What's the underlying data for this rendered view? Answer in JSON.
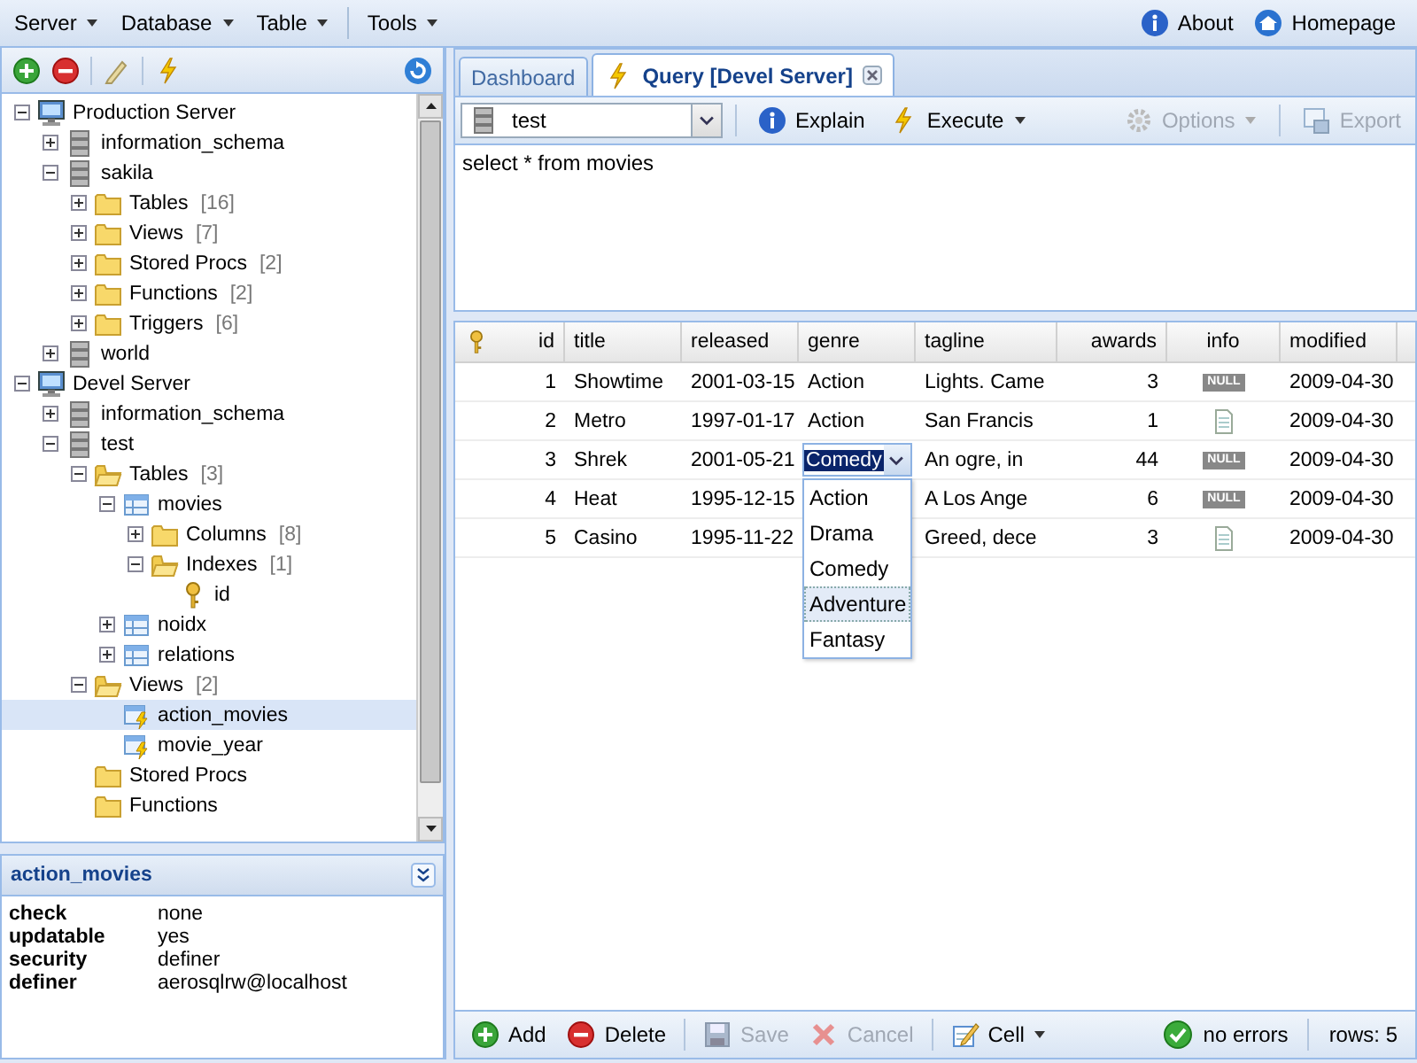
{
  "menu": {
    "groups": [
      [
        {
          "label": "Server"
        },
        {
          "label": "Database"
        },
        {
          "label": "Table"
        }
      ],
      [
        {
          "label": "Tools"
        }
      ]
    ],
    "links": [
      {
        "label": "About",
        "kind": "info"
      },
      {
        "label": "Homepage",
        "kind": "home"
      }
    ]
  },
  "tree": [
    {
      "label": "Production Server",
      "kind": "server",
      "expanded": true,
      "selected": false,
      "children": [
        {
          "label": "information_schema",
          "kind": "database",
          "expanded": false,
          "selected": false
        },
        {
          "label": "sakila",
          "kind": "database",
          "expanded": true,
          "selected": false,
          "children": [
            {
              "label": "Tables",
              "count": "[16]",
              "kind": "folder",
              "expanded": false,
              "selected": false
            },
            {
              "label": "Views",
              "count": "[7]",
              "kind": "folder",
              "expanded": false,
              "selected": false
            },
            {
              "label": "Stored Procs",
              "count": "[2]",
              "kind": "folder",
              "expanded": false,
              "selected": false
            },
            {
              "label": "Functions",
              "count": "[2]",
              "kind": "folder",
              "expanded": false,
              "selected": false
            },
            {
              "label": "Triggers",
              "count": "[6]",
              "kind": "folder",
              "expanded": false,
              "selected": false
            }
          ]
        },
        {
          "label": "world",
          "kind": "database",
          "expanded": false,
          "selected": false
        }
      ]
    },
    {
      "label": "Devel Server",
      "kind": "server",
      "expanded": true,
      "selected": false,
      "children": [
        {
          "label": "information_schema",
          "kind": "database",
          "expanded": false,
          "selected": false
        },
        {
          "label": "test",
          "kind": "database",
          "expanded": true,
          "selected": false,
          "children": [
            {
              "label": "Tables",
              "count": "[3]",
              "kind": "folder",
              "expanded": true,
              "selected": false,
              "children": [
                {
                  "label": "movies",
                  "kind": "table",
                  "expanded": true,
                  "selected": false,
                  "children": [
                    {
                      "label": "Columns",
                      "count": "[8]",
                      "kind": "folder",
                      "expanded": false,
                      "selected": false
                    },
                    {
                      "label": "Indexes",
                      "count": "[1]",
                      "kind": "folder",
                      "expanded": true,
                      "selected": false,
                      "children": [
                        {
                          "label": "id",
                          "kind": "key",
                          "selected": false
                        }
                      ]
                    }
                  ]
                },
                {
                  "label": "noidx",
                  "kind": "table",
                  "expanded": false,
                  "selected": false
                },
                {
                  "label": "relations",
                  "kind": "table",
                  "expanded": false,
                  "selected": false
                }
              ]
            },
            {
              "label": "Views",
              "count": "[2]",
              "kind": "folder",
              "expanded": true,
              "selected": false,
              "children": [
                {
                  "label": "action_movies",
                  "kind": "view",
                  "selected": true
                },
                {
                  "label": "movie_year",
                  "kind": "view",
                  "selected": false
                }
              ]
            },
            {
              "label": "Stored Procs",
              "kind": "folder",
              "selected": false
            },
            {
              "label": "Functions",
              "kind": "folder",
              "selected": false
            }
          ]
        }
      ]
    }
  ],
  "details": {
    "title": "action_movies",
    "properties": [
      {
        "name": "check",
        "value": "none"
      },
      {
        "name": "updatable",
        "value": "yes"
      },
      {
        "name": "security",
        "value": "definer"
      },
      {
        "name": "definer",
        "value": "aerosqlrw@localhost"
      }
    ]
  },
  "tabs": [
    {
      "label": "Dashboard",
      "kind": "plain",
      "selected": false,
      "closable": false
    },
    {
      "label": "Query [Devel Server]",
      "kind": "query",
      "selected": true,
      "closable": true
    }
  ],
  "query": {
    "database": "test",
    "sql": "select * from movies",
    "actions": [
      {
        "label": "Explain",
        "kind": "info",
        "disabled": false,
        "menu": false
      },
      {
        "label": "Execute",
        "kind": "execute",
        "disabled": false,
        "menu": true
      }
    ],
    "right_groups": [
      [
        {
          "label": "Options",
          "kind": "options",
          "disabled": true,
          "menu": true
        }
      ],
      [
        {
          "label": "Export",
          "kind": "export",
          "disabled": true,
          "menu": false
        }
      ]
    ]
  },
  "grid": {
    "columns": [
      {
        "label": "id",
        "kind": "number",
        "key": true
      },
      {
        "label": "title",
        "kind": "text"
      },
      {
        "label": "released",
        "kind": "text"
      },
      {
        "label": "genre",
        "kind": "text"
      },
      {
        "label": "tagline",
        "kind": "wide"
      },
      {
        "label": "awards",
        "kind": "number"
      },
      {
        "label": "info",
        "kind": "icon"
      },
      {
        "label": "modified",
        "kind": "text"
      }
    ],
    "rows": [
      {
        "cells": [
          "1",
          "Showtime",
          "2001-03-15",
          "Action",
          "Lights. Came",
          "3",
          {
            "kind": "null",
            "label": "NULL"
          },
          "2009-04-30"
        ]
      },
      {
        "cells": [
          "2",
          "Metro",
          "1997-01-17",
          "Action",
          "San Francis",
          "1",
          {
            "kind": "document"
          },
          "2009-04-30"
        ]
      },
      {
        "cells": [
          "3",
          "Shrek",
          "2001-05-21",
          {
            "kind": "editor",
            "value": "Comedy",
            "expanded": true,
            "options": [
              {
                "label": "Action",
                "highlighted": false
              },
              {
                "label": "Drama",
                "highlighted": false
              },
              {
                "label": "Comedy",
                "highlighted": false
              },
              {
                "label": "Adventure",
                "highlighted": true
              },
              {
                "label": "Fantasy",
                "highlighted": false
              }
            ]
          },
          "An ogre, in",
          "44",
          {
            "kind": "null",
            "label": "NULL"
          },
          "2009-04-30"
        ]
      },
      {
        "cells": [
          "4",
          "Heat",
          "1995-12-15",
          null,
          "A Los Ange",
          "6",
          {
            "kind": "null",
            "label": "NULL"
          },
          "2009-04-30"
        ]
      },
      {
        "cells": [
          "5",
          "Casino",
          "1995-11-22",
          null,
          "Greed, dece",
          "3",
          {
            "kind": "document"
          },
          "2009-04-30"
        ]
      }
    ]
  },
  "bottom_bar": {
    "groups": [
      [
        {
          "label": "Add",
          "kind": "add",
          "disabled": false
        },
        {
          "label": "Delete",
          "kind": "delete",
          "disabled": false
        }
      ],
      [
        {
          "label": "Save",
          "kind": "save",
          "disabled": true
        },
        {
          "label": "Cancel",
          "kind": "cancel",
          "disabled": true
        }
      ],
      [
        {
          "label": "Cell",
          "kind": "cell",
          "disabled": false,
          "menu": true
        }
      ]
    ],
    "status": "no errors",
    "rows": "rows: 5"
  }
}
